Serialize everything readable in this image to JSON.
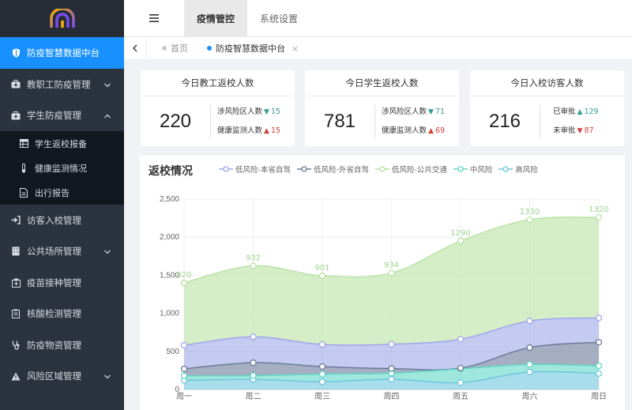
{
  "sidebar": {
    "items": [
      {
        "label": "防疫智慧数据中台",
        "icon": "shield-icon",
        "active": true
      },
      {
        "label": "教职工防疫管理",
        "icon": "medkit-icon",
        "expand": "down"
      },
      {
        "label": "学生防疫管理",
        "icon": "medkit-icon",
        "expand": "up"
      }
    ],
    "sub_items": [
      {
        "label": "学生返校报备",
        "icon": "table-icon"
      },
      {
        "label": "健康监测情况",
        "icon": "thermometer-icon"
      },
      {
        "label": "出行报告",
        "icon": "file-icon"
      }
    ],
    "items2": [
      {
        "label": "访客入校管理",
        "icon": "sign-in-icon"
      },
      {
        "label": "公共场所管理",
        "icon": "building-icon",
        "expand": "down"
      },
      {
        "label": "疫苗接种管理",
        "icon": "hospital-icon"
      },
      {
        "label": "核酸检测管理",
        "icon": "clipboard-icon"
      },
      {
        "label": "防疫物资管理",
        "icon": "stethoscope-icon"
      },
      {
        "label": "风险区域管理",
        "icon": "warning-icon",
        "expand": "down"
      }
    ]
  },
  "topbar": {
    "tabs": [
      {
        "label": "疫情管控",
        "active": true
      },
      {
        "label": "系统设置",
        "active": false
      }
    ]
  },
  "tagbar": {
    "tags": [
      {
        "label": "首页",
        "active": false
      },
      {
        "label": "防疫智慧数据中台",
        "active": true,
        "closable": "×"
      }
    ]
  },
  "cards": [
    {
      "title": "今日教工返校人数",
      "value": "220",
      "rows": [
        {
          "label": "涉风险区人数",
          "dir": "down",
          "arrow": "▼",
          "num": "15"
        },
        {
          "label": "健康监测人数",
          "dir": "up",
          "arrow": "▲",
          "num": "15"
        }
      ]
    },
    {
      "title": "今日学生返校人数",
      "value": "781",
      "rows": [
        {
          "label": "涉风险区人数",
          "dir": "down",
          "arrow": "▼",
          "num": "71"
        },
        {
          "label": "健康监测人数",
          "dir": "up",
          "arrow": "▲",
          "num": "69"
        }
      ]
    },
    {
      "title": "今日入校访客人数",
      "value": "216",
      "rows": [
        {
          "label": "已审批",
          "dir": "upgreen",
          "arrow": "▲",
          "num": "129"
        },
        {
          "label": "未审批",
          "dir": "downred",
          "arrow": "▼",
          "num": "87"
        }
      ]
    }
  ],
  "colors": {
    "accent": "#1890ff",
    "sidebar_bg": "#2b333e",
    "submenu_bg": "#121820"
  },
  "chart_data": {
    "type": "area",
    "title": "返校情况",
    "categories": [
      "周一",
      "周二",
      "周三",
      "周四",
      "周五",
      "周六",
      "周日"
    ],
    "ylim": [
      0,
      2500
    ],
    "yticks": [
      "0",
      "500",
      "1,000",
      "1,500",
      "2,000",
      "2,500"
    ],
    "stacked": true,
    "series": [
      {
        "name": "高风险",
        "color": "#6ec6e0",
        "values": [
          120,
          132,
          101,
          134,
          90,
          230,
          210
        ]
      },
      {
        "name": "中风险",
        "color": "#5fd6c4",
        "values": [
          60,
          50,
          100,
          80,
          180,
          100,
          100
        ]
      },
      {
        "name": "低风险-外省自驾",
        "color": "#6b7a9a",
        "values": [
          90,
          170,
          100,
          60,
          10,
          220,
          310
        ]
      },
      {
        "name": "低风险-本省自驾",
        "color": "#9ea6e8",
        "values": [
          310,
          340,
          290,
          320,
          380,
          350,
          320
        ]
      },
      {
        "name": "低风险-公共交通",
        "color": "#b9e3a4",
        "values": [
          820,
          932,
          901,
          934,
          1290,
          1330,
          1320
        ]
      }
    ],
    "legend_order": [
      "低风险-本省自驾",
      "低风险-外省自驾",
      "低风险-公共交通",
      "中风险",
      "高风险"
    ],
    "top_labels": [
      "820",
      "932",
      "901",
      "934",
      "1290",
      "1330",
      "1320"
    ],
    "grid": true,
    "legend_position": "top"
  }
}
